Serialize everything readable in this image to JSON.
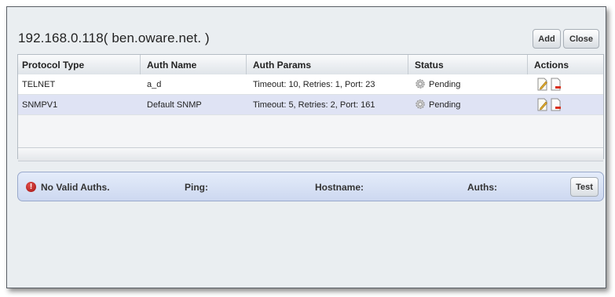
{
  "dialog": {
    "title": "192.168.0.118( ben.oware.net. )",
    "add_label": "Add",
    "close_label": "Close"
  },
  "table": {
    "columns": [
      "Protocol Type",
      "Auth Name",
      "Auth Params",
      "Status",
      "Actions"
    ],
    "rows": [
      {
        "protocol": "TELNET",
        "auth_name": "a_d",
        "auth_params": "Timeout: 10, Retries: 1, Port: 23",
        "status": "Pending",
        "status_icon": "gear-icon",
        "actions": [
          "edit-icon",
          "delete-icon"
        ]
      },
      {
        "protocol": "SNMPV1",
        "auth_name": "Default SNMP",
        "auth_params": "Timeout: 5, Retries: 2, Port: 161",
        "status": "Pending",
        "status_icon": "gear-icon",
        "actions": [
          "edit-icon",
          "delete-icon"
        ]
      }
    ]
  },
  "status_bar": {
    "message": "No Valid Auths.",
    "ping_label": "Ping:",
    "hostname_label": "Hostname:",
    "auths_label": "Auths:",
    "test_label": "Test",
    "error_icon": "error-icon"
  }
}
